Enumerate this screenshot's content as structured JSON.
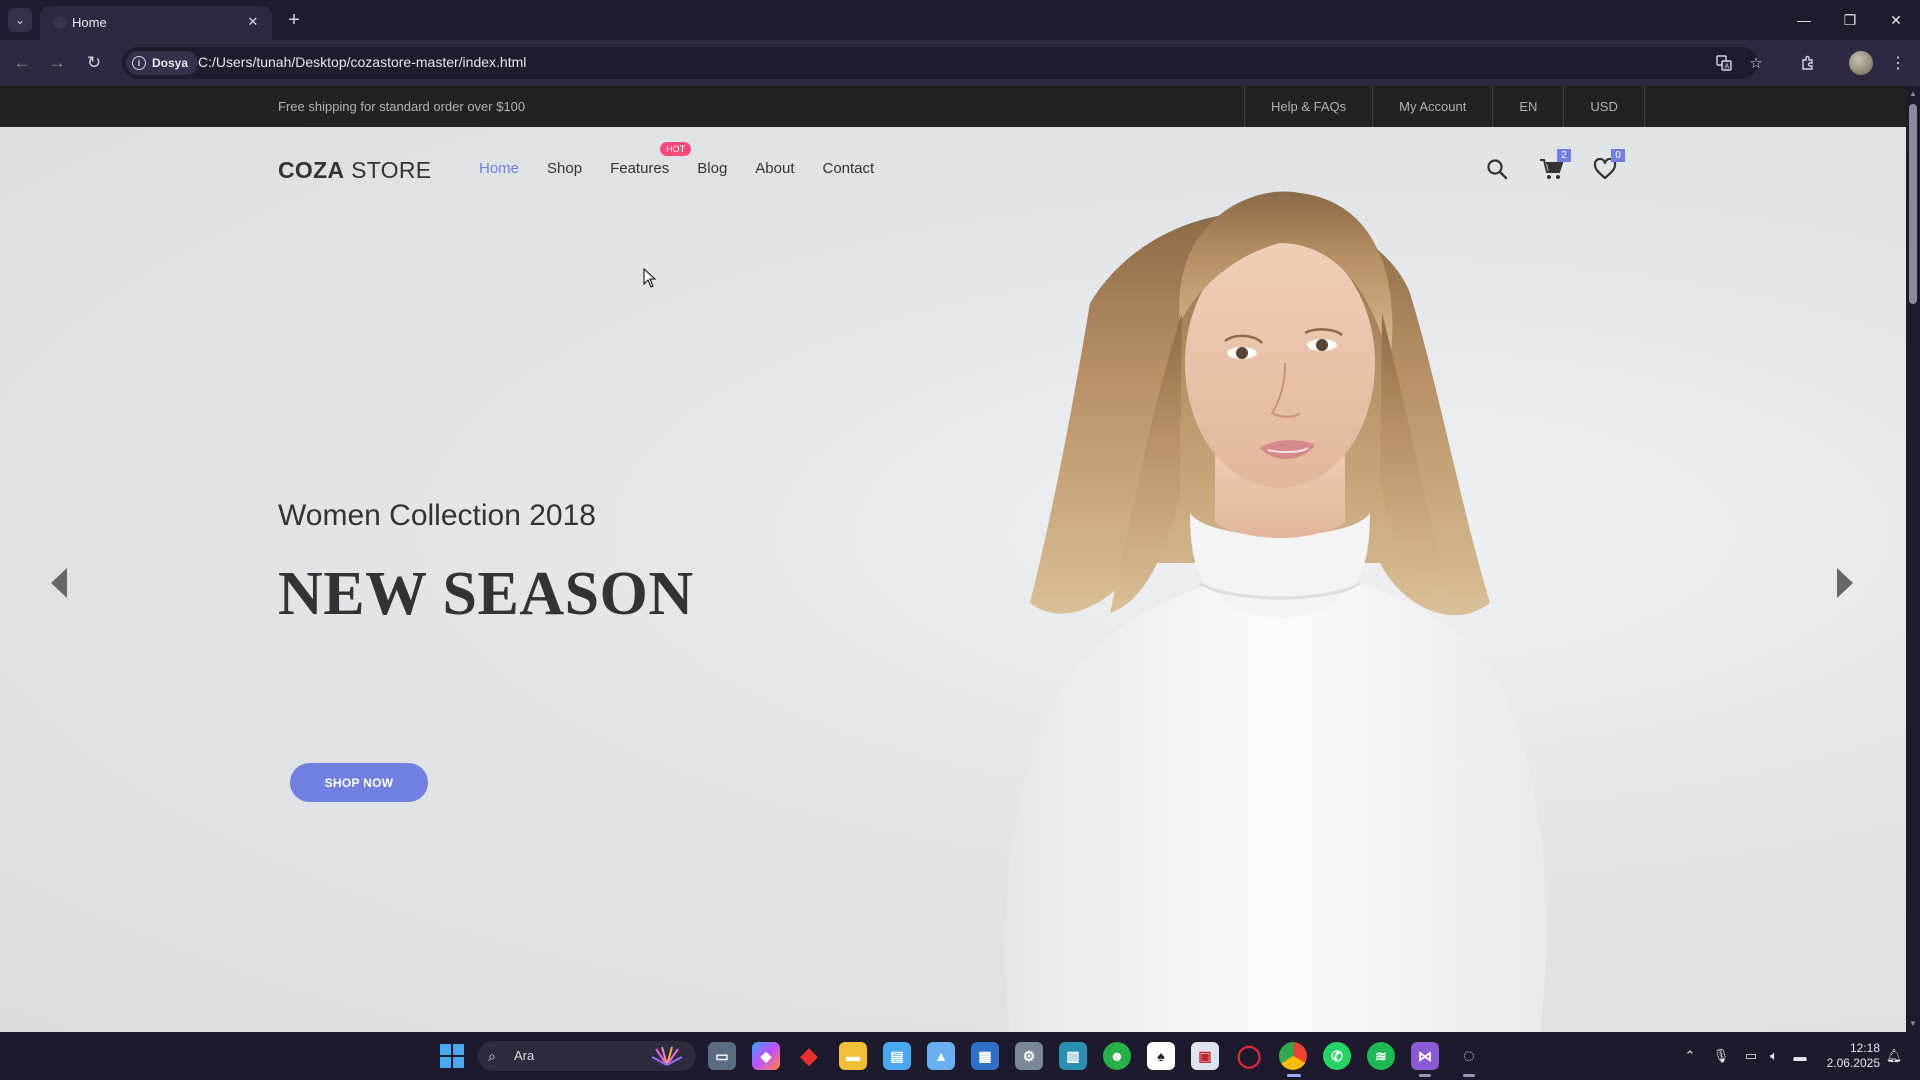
{
  "browser": {
    "tab_title": "Home",
    "site_chip": "Dosya",
    "url": "C:/Users/tunah/Desktop/cozastore-master/index.html",
    "icons": [
      "tab-list-icon",
      "close-icon",
      "plus-icon",
      "minimize-icon",
      "restore-icon",
      "close-window-icon",
      "back-icon",
      "forward-icon",
      "reload-icon",
      "info-icon",
      "translate-icon",
      "star-icon",
      "extensions-icon",
      "profile-avatar",
      "more-icon"
    ]
  },
  "site": {
    "topbar": {
      "shipping_text": "Free shipping for standard order over $100",
      "links": [
        "Help & FAQs",
        "My Account",
        "EN",
        "USD"
      ]
    },
    "logo": {
      "bold": "COZA",
      "light": "STORE"
    },
    "nav": [
      {
        "label": "Home",
        "active": true
      },
      {
        "label": "Shop"
      },
      {
        "label": "Features",
        "badge": "HOT"
      },
      {
        "label": "Blog"
      },
      {
        "label": "About"
      },
      {
        "label": "Contact"
      }
    ],
    "cart_count": "2",
    "wishlist_count": "0",
    "hero": {
      "subtitle": "Women Collection 2018",
      "headline": "NEW SEASON",
      "cta": "SHOP NOW"
    },
    "colors": {
      "accent": "#717fe0",
      "hot_badge": "#f74877",
      "topbar_bg": "#222222",
      "text": "#333333"
    }
  },
  "taskbar": {
    "search_label": "Ara",
    "time": "12:18",
    "date": "2.06.2025"
  }
}
